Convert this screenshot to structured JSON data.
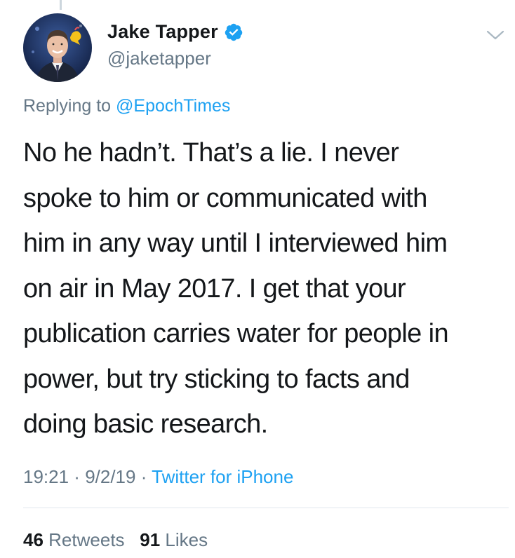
{
  "tweet": {
    "author": {
      "display_name": "Jake Tapper",
      "handle": "@jaketapper",
      "verified_icon": "verified-badge-icon"
    },
    "menu_icon": "chevron-down-icon",
    "replying_prefix": "Replying to",
    "replying_to": "@EpochTimes",
    "text_lines": [
      "No he hadn’t. That’s a lie. I never",
      "spoke to him or communicated with",
      "him in any way until I interviewed him",
      "on air in May 2017. I get that your",
      "publication carries water for people in",
      "power, but try sticking to facts and",
      "doing basic research."
    ],
    "time": "19:21",
    "separator": " · ",
    "date": "9/2/19",
    "source": "Twitter for iPhone",
    "retweets_count": "46",
    "retweets_label": "Retweets",
    "likes_count": "91",
    "likes_label": "Likes"
  },
  "colors": {
    "accent": "#1da1f2",
    "secondary_text": "#657786",
    "primary_text": "#14171a",
    "divider": "#e1e8ed"
  }
}
